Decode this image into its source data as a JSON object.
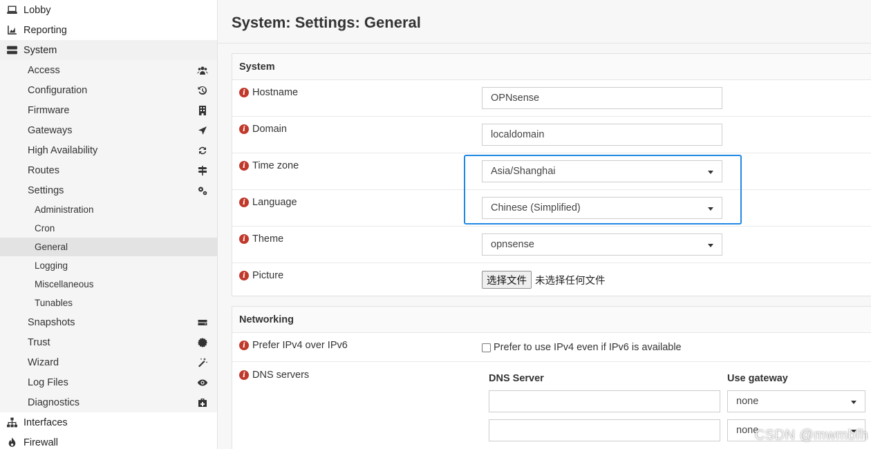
{
  "sidebar": {
    "top_before": [
      {
        "label": "Lobby",
        "icon": "laptop-icon"
      },
      {
        "label": "Reporting",
        "icon": "area-chart-icon"
      },
      {
        "label": "System",
        "icon": "server-icon"
      }
    ],
    "system_items": [
      {
        "label": "Access",
        "icon": "users-icon"
      },
      {
        "label": "Configuration",
        "icon": "history-icon"
      },
      {
        "label": "Firmware",
        "icon": "building-icon"
      },
      {
        "label": "Gateways",
        "icon": "location-arrow-icon"
      },
      {
        "label": "High Availability",
        "icon": "refresh-icon"
      },
      {
        "label": "Routes",
        "icon": "signpost-icon"
      },
      {
        "label": "Settings",
        "icon": "cogs-icon"
      }
    ],
    "settings_children": [
      "Administration",
      "Cron",
      "General",
      "Logging",
      "Miscellaneous",
      "Tunables"
    ],
    "active_child": "General",
    "system_items_after": [
      {
        "label": "Snapshots",
        "icon": "hdd-icon"
      },
      {
        "label": "Trust",
        "icon": "certificate-icon"
      },
      {
        "label": "Wizard",
        "icon": "magic-icon"
      },
      {
        "label": "Log Files",
        "icon": "eye-icon"
      },
      {
        "label": "Diagnostics",
        "icon": "medkit-icon"
      }
    ],
    "top_after": [
      {
        "label": "Interfaces",
        "icon": "sitemap-icon"
      },
      {
        "label": "Firewall",
        "icon": "fire-icon"
      }
    ]
  },
  "page": {
    "title": "System: Settings: General"
  },
  "system_panel": {
    "heading": "System",
    "hostname": {
      "label": "Hostname",
      "value": "OPNsense"
    },
    "domain": {
      "label": "Domain",
      "value": "localdomain"
    },
    "timezone": {
      "label": "Time zone",
      "value": "Asia/Shanghai"
    },
    "language": {
      "label": "Language",
      "value": "Chinese (Simplified)"
    },
    "theme": {
      "label": "Theme",
      "value": "opnsense"
    },
    "picture": {
      "label": "Picture",
      "button": "选择文件",
      "status": "未选择任何文件"
    }
  },
  "networking_panel": {
    "heading": "Networking",
    "prefer_ipv4": {
      "label": "Prefer IPv4 over IPv6",
      "checkbox_label": "Prefer to use IPv4 even if IPv6 is available"
    },
    "dns": {
      "label": "DNS servers",
      "col_server": "DNS Server",
      "col_gateway": "Use gateway",
      "rows": [
        {
          "server": "",
          "gateway": "none"
        },
        {
          "server": "",
          "gateway": "none"
        }
      ]
    }
  },
  "watermark": "CSDN @mwmbfh",
  "colors": {
    "highlight": "#1e88e5",
    "info_icon": "#c0392b"
  }
}
